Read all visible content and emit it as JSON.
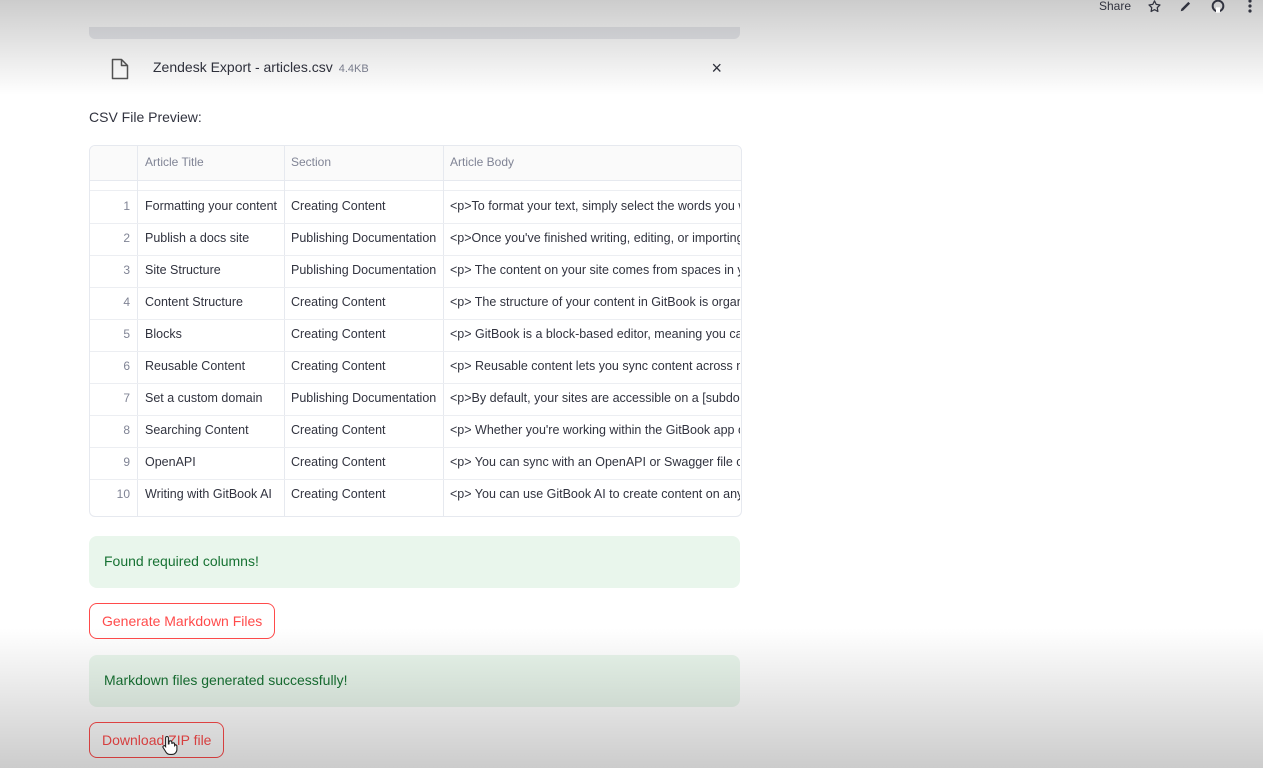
{
  "toolbar": {
    "share_label": "Share",
    "icons": [
      "star-icon",
      "pencil-icon",
      "github-icon",
      "more-vert-icon"
    ]
  },
  "uploader": {
    "file_name": "Zendesk Export - articles.csv",
    "file_size": "4.4KB",
    "close_glyph": "×"
  },
  "preview_label": "CSV File Preview:",
  "table": {
    "columns": [
      "Article Title",
      "Section",
      "Article Body"
    ],
    "rows": [
      {
        "index": "1",
        "title": "Formatting your content",
        "section": "Creating Content",
        "body": "<p>To format your text, simply select the words you w"
      },
      {
        "index": "2",
        "title": "Publish a docs site",
        "section": "Publishing Documentation",
        "body": "<p>Once you've finished writing, editing, or importing"
      },
      {
        "index": "3",
        "title": "Site Structure",
        "section": "Publishing Documentation",
        "body": "<p> The content on your site comes from spaces in you"
      },
      {
        "index": "4",
        "title": "Content Structure",
        "section": "Creating Content",
        "body": "<p> The structure of your content in GitBook is organiz"
      },
      {
        "index": "5",
        "title": "Blocks",
        "section": "Creating Content",
        "body": "<p> GitBook is a block-based editor, meaning you can"
      },
      {
        "index": "6",
        "title": "Reusable Content",
        "section": "Creating Content",
        "body": "<p> Reusable content lets you sync content across mu"
      },
      {
        "index": "7",
        "title": "Set a custom domain",
        "section": "Publishing Documentation",
        "body": "<p>By default, your sites are accessible on a [subdoma"
      },
      {
        "index": "8",
        "title": "Searching Content",
        "section": "Creating Content",
        "body": "<p> Whether you're working within the GitBook app o"
      },
      {
        "index": "9",
        "title": "OpenAPI",
        "section": "Creating Content",
        "body": "<p> You can sync with an OpenAPI or Swagger file or U"
      },
      {
        "index": "10",
        "title": "Writing with GitBook AI",
        "section": "Creating Content",
        "body": "<p> You can use GitBook AI to create content on any e"
      }
    ]
  },
  "alerts": {
    "columns_found": "Found required columns!",
    "generated": "Markdown files generated successfully!"
  },
  "buttons": {
    "generate": "Generate Markdown Files",
    "download": "Download ZIP file"
  },
  "colors": {
    "accent": "#ff4b4b",
    "success_bg": "#e9f6ec",
    "success_text": "#177233"
  }
}
